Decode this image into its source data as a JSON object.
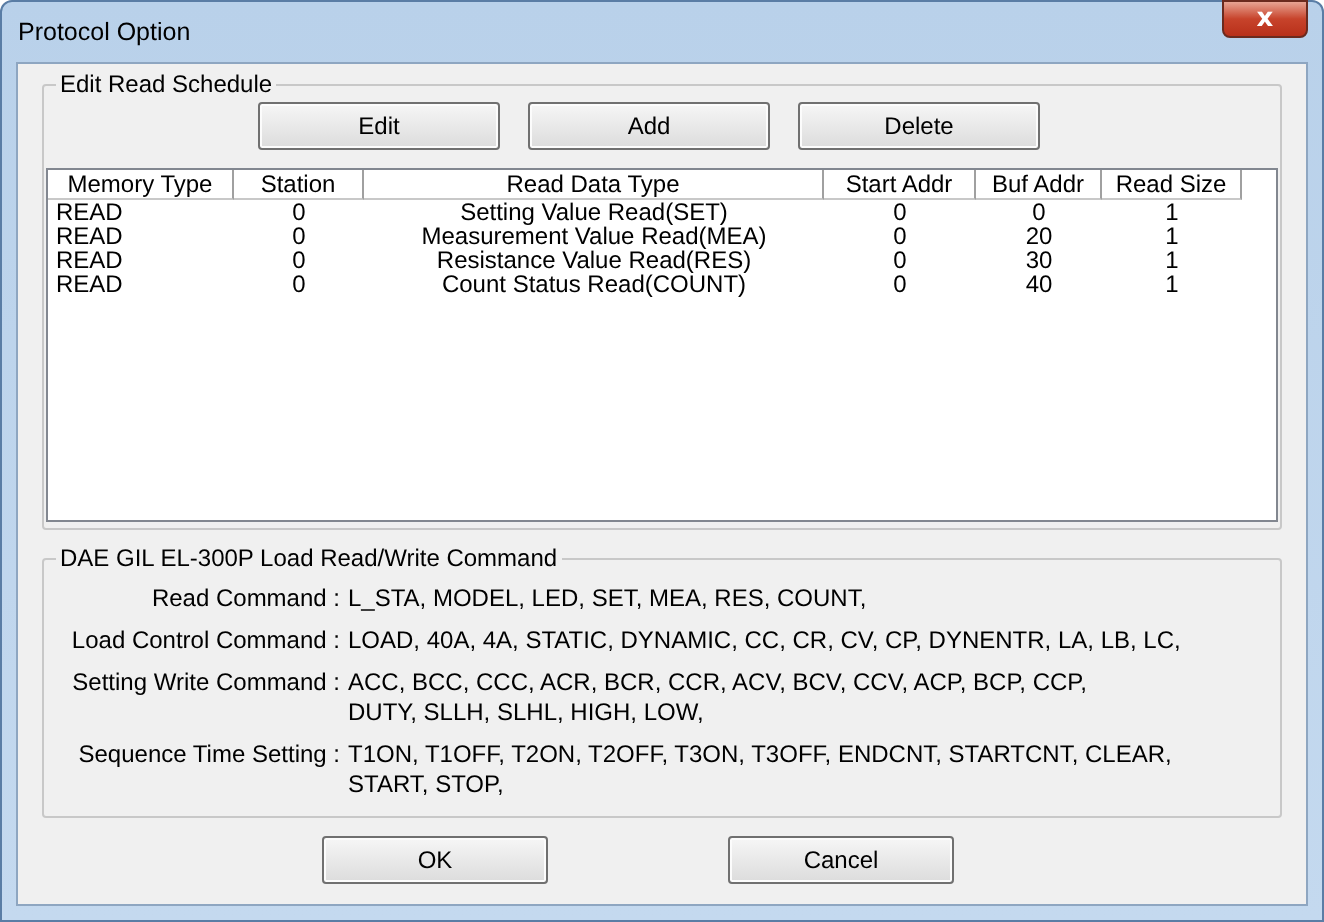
{
  "window": {
    "title": "Protocol Option",
    "close_label": "x"
  },
  "read_schedule": {
    "title": "Edit Read Schedule",
    "buttons": [
      "Edit",
      "Add",
      "Delete"
    ],
    "columns": [
      "Memory Type",
      "Station",
      "Read Data Type",
      "Start Addr",
      "Buf Addr",
      "Read Size"
    ],
    "rows": [
      [
        "READ",
        "0",
        "Setting Value Read(SET)",
        "0",
        "0",
        "1"
      ],
      [
        "READ",
        "0",
        "Measurement Value Read(MEA)",
        "0",
        "20",
        "1"
      ],
      [
        "READ",
        "0",
        "Resistance Value Read(RES)",
        "0",
        "30",
        "1"
      ],
      [
        "READ",
        "0",
        "Count Status Read(COUNT)",
        "0",
        "40",
        "1"
      ]
    ]
  },
  "commands": {
    "title": "DAE GIL EL-300P Load Read/Write Command",
    "items": [
      {
        "label": "Read Command :",
        "value": "L_STA, MODEL, LED, SET,  MEA, RES, COUNT,"
      },
      {
        "label": "Load Control Command :",
        "value": "LOAD, 40A, 4A, STATIC,  DYNAMIC, CC, CR, CV, CP, DYNENTR, LA, LB, LC,"
      },
      {
        "label": "Setting Write Command :",
        "value": "ACC, BCC, CCC, ACR, BCR, CCR, ACV, BCV, CCV, ACP, BCP, CCP,\nDUTY, SLLH, SLHL, HIGH, LOW,"
      },
      {
        "label": "Sequence Time Setting :",
        "value": "T1ON, T1OFF, T2ON, T2OFF, T3ON, T3OFF, ENDCNT, STARTCNT, CLEAR,\nSTART, STOP,"
      }
    ]
  },
  "footer_buttons": [
    "OK",
    "Cancel"
  ]
}
